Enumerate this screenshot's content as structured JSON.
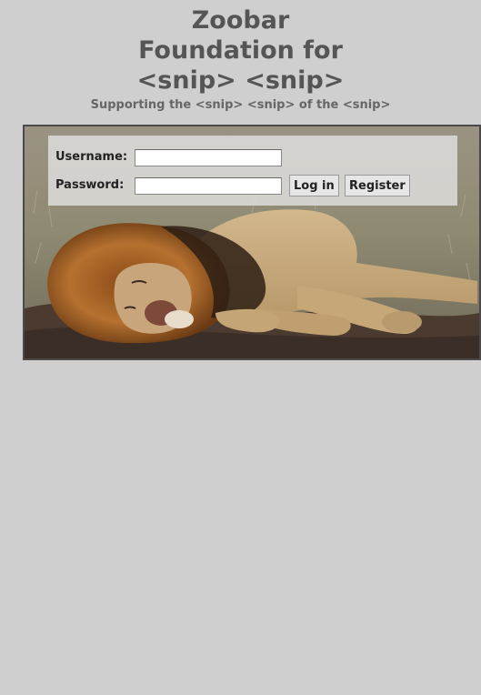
{
  "header": {
    "title_line1": "Zoobar",
    "title_line2": "Foundation for",
    "title_line3": "<snip> <snip>",
    "subtitle": "Supporting the <snip> <snip> of the <snip>"
  },
  "login": {
    "username_label": "Username:",
    "password_label": "Password:",
    "username_value": "",
    "password_value": "",
    "login_button": "Log in",
    "register_button": "Register"
  },
  "banner": {
    "image_subject": "sleeping-lion"
  }
}
